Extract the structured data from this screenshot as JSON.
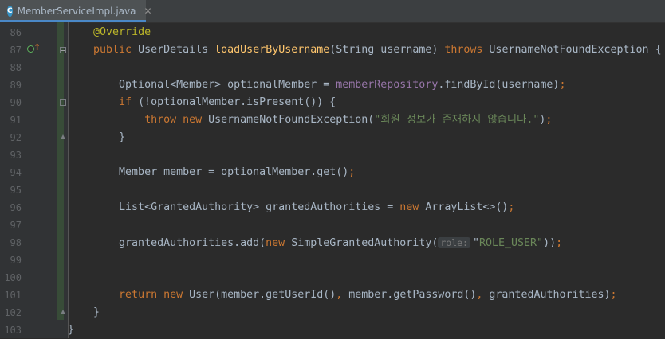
{
  "tab": {
    "icon_letter": "C",
    "file_name": "MemberServiceImpl.java",
    "close_glyph": "✕"
  },
  "editor": {
    "lines": [
      {
        "n": "86",
        "tokens": [
          {
            "t": "    "
          },
          {
            "t": "@Override",
            "c": "ann"
          }
        ]
      },
      {
        "n": "87",
        "tokens": [
          {
            "t": "    "
          },
          {
            "t": "public",
            "c": "kw"
          },
          {
            "t": " UserDetails "
          },
          {
            "t": "loadUserByUsername",
            "c": "fn"
          },
          {
            "t": "(String username) "
          },
          {
            "t": "throws",
            "c": "kw"
          },
          {
            "t": " UsernameNotFoundException {"
          }
        ]
      },
      {
        "n": "88",
        "tokens": []
      },
      {
        "n": "89",
        "tokens": [
          {
            "t": "        Optional<Member> optionalMember = "
          },
          {
            "t": "memberRepository",
            "c": "fld"
          },
          {
            "t": ".findById(username)"
          },
          {
            "t": ";",
            "c": "kw"
          }
        ]
      },
      {
        "n": "90",
        "tokens": [
          {
            "t": "        "
          },
          {
            "t": "if",
            "c": "kw"
          },
          {
            "t": " (!optionalMember.isPresent()) {"
          }
        ]
      },
      {
        "n": "91",
        "tokens": [
          {
            "t": "            "
          },
          {
            "t": "throw new",
            "c": "kw"
          },
          {
            "t": " UsernameNotFoundException("
          },
          {
            "t": "\"회원 정보가 존재하지 않습니다.\"",
            "c": "str"
          },
          {
            "t": ")"
          },
          {
            "t": ";",
            "c": "kw"
          }
        ]
      },
      {
        "n": "92",
        "tokens": [
          {
            "t": "        }"
          }
        ]
      },
      {
        "n": "93",
        "tokens": []
      },
      {
        "n": "94",
        "tokens": [
          {
            "t": "        Member member = optionalMember.get()"
          },
          {
            "t": ";",
            "c": "kw"
          }
        ]
      },
      {
        "n": "95",
        "tokens": []
      },
      {
        "n": "96",
        "tokens": [
          {
            "t": "        List<GrantedAuthority> grantedAuthorities = "
          },
          {
            "t": "new",
            "c": "kw"
          },
          {
            "t": " ArrayList<>()"
          },
          {
            "t": ";",
            "c": "kw"
          }
        ]
      },
      {
        "n": "97",
        "tokens": []
      },
      {
        "n": "98",
        "tokens": [
          {
            "t": "        grantedAuthorities.add("
          },
          {
            "t": "new",
            "c": "kw"
          },
          {
            "t": " SimpleGrantedAuthority("
          },
          {
            "t": "role:",
            "c": "hint"
          },
          {
            "t": "\""
          },
          {
            "t": "ROLE_USER",
            "c": "str ul"
          },
          {
            "t": "\"",
            "c": "str"
          },
          {
            "t": "))"
          },
          {
            "t": ";",
            "c": "kw"
          }
        ]
      },
      {
        "n": "99",
        "tokens": []
      },
      {
        "n": "100",
        "tokens": []
      },
      {
        "n": "101",
        "tokens": [
          {
            "t": "        "
          },
          {
            "t": "return new",
            "c": "kw"
          },
          {
            "t": " User(member.getUserId()"
          },
          {
            "t": ",",
            "c": "kw"
          },
          {
            "t": " member.getPassword()"
          },
          {
            "t": ",",
            "c": "kw"
          },
          {
            "t": " grantedAuthorities)"
          },
          {
            "t": ";",
            "c": "kw"
          }
        ]
      },
      {
        "n": "102",
        "tokens": [
          {
            "t": "    }"
          }
        ]
      },
      {
        "n": "103",
        "tokens": [
          {
            "t": "}"
          }
        ]
      }
    ]
  }
}
